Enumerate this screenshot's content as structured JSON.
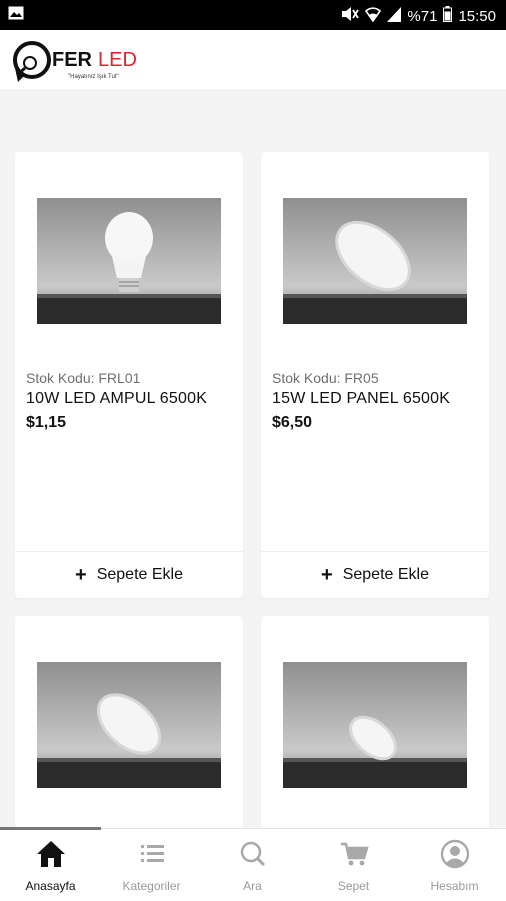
{
  "status_bar": {
    "battery": "%71",
    "time": "15:50",
    "icons": [
      "image-icon",
      "mute-icon",
      "wifi-icon",
      "signal-icon",
      "battery-icon"
    ]
  },
  "header": {
    "logo_text_dark": "FER",
    "logo_text_red": "LED",
    "logo_tagline": "\"Hayatınız Işık Tut\"",
    "brand_color": "#d8262f"
  },
  "products": [
    {
      "code": "Stok Kodu: FRL01",
      "name": "10W LED AMPUL 6500K",
      "price": "$1,15",
      "add_label": "Sepete Ekle",
      "image": "bulb"
    },
    {
      "code": "Stok Kodu: FR05",
      "name": "15W LED PANEL 6500K",
      "price": "$6,50",
      "add_label": "Sepete Ekle",
      "image": "panel"
    },
    {
      "code": "",
      "name": "",
      "price": "",
      "add_label": "",
      "image": "panel"
    },
    {
      "code": "",
      "name": "",
      "price": "",
      "add_label": "",
      "image": "panel-small"
    }
  ],
  "bottom_nav": [
    {
      "label": "Anasayfa",
      "icon": "home-icon",
      "active": true
    },
    {
      "label": "Kategoriler",
      "icon": "list-icon",
      "active": false
    },
    {
      "label": "Ara",
      "icon": "search-icon",
      "active": false
    },
    {
      "label": "Sepet",
      "icon": "cart-icon",
      "active": false
    },
    {
      "label": "Hesabım",
      "icon": "account-icon",
      "active": false
    }
  ]
}
